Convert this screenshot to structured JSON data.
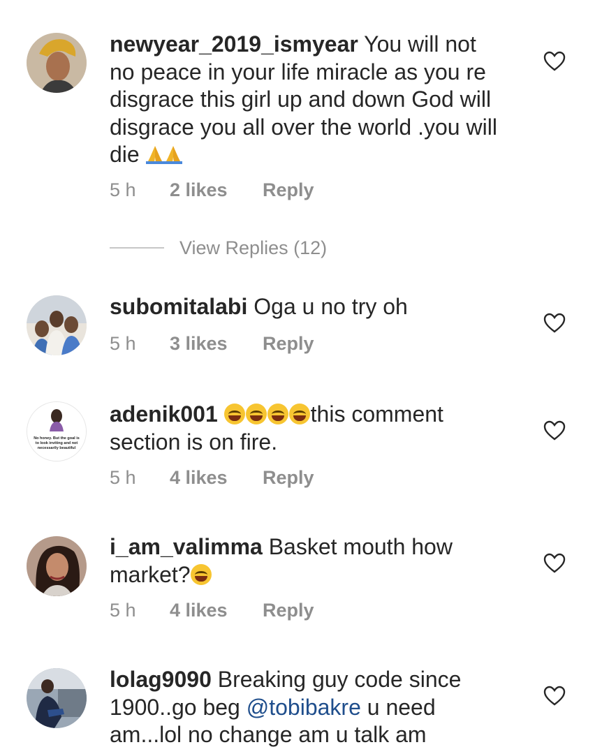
{
  "comments": [
    {
      "username": "newyear_2019_ismyear",
      "text_lines": [
        "You will not",
        "no peace in your life miracle as you re",
        "disgrace this girl up and down God will",
        "disgrace you all over the world .you will",
        "die"
      ],
      "time": "5 h",
      "likes": "2 likes",
      "reply": "Reply",
      "view_replies": "View Replies (12)",
      "avatar_icon": "avatar-icon"
    },
    {
      "username": "subomitalabi",
      "text": "Oga u no try oh",
      "time": "5 h",
      "likes": "3 likes",
      "reply": "Reply",
      "avatar_icon": "avatar-icon"
    },
    {
      "username": "adenik001",
      "text_after_emoji": "this comment",
      "text_line2": "section is on fire.",
      "time": "5 h",
      "likes": "4 likes",
      "reply": "Reply",
      "avatar_caption": "No honey. But the goal is to look inviting and not necessarily beautiful"
    },
    {
      "username": "i_am_valimma",
      "text": "Basket mouth how",
      "text_line2": "market?",
      "time": "5 h",
      "likes": "4 likes",
      "reply": "Reply"
    },
    {
      "username": "lolag9090",
      "text": "Breaking guy code since",
      "text_line2_before": "1900..go beg",
      "mention": "@tobibakre",
      "text_line2_after": "u need",
      "text_line3": "am...lol no change am u talk am"
    }
  ],
  "colors": {
    "text": "#262626",
    "meta": "#8e8e8e",
    "mention": "#1f4e8c"
  }
}
